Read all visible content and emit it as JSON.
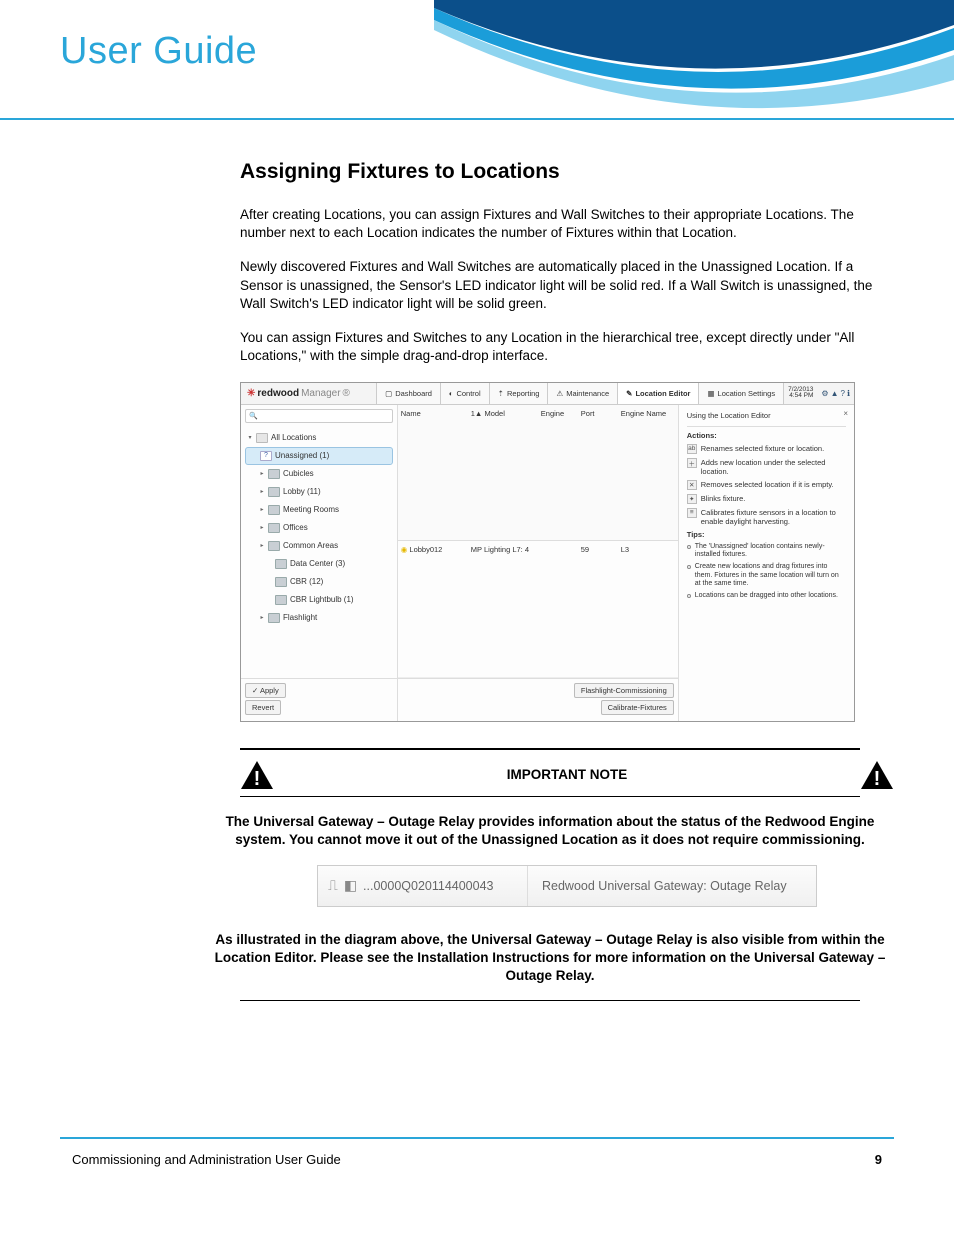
{
  "header": {
    "title": "User Guide"
  },
  "section": {
    "heading": "Assigning Fixtures to Locations"
  },
  "paragraphs": {
    "p1": "After creating Locations, you can assign Fixtures and Wall Switches to their appropriate Locations. The number next to each Location indicates the number of Fixtures within that Location.",
    "p2": "Newly discovered Fixtures and Wall Switches are automatically placed in the Unassigned Location. If a Sensor is unassigned, the Sensor's LED indicator light will be solid red. If a Wall Switch is unassigned, the Wall Switch's LED indicator light will be solid green.",
    "p3": "You can assign Fixtures and Switches to any Location in the hierarchical tree, except directly under \"All Locations,\" with the simple drag-and-drop interface."
  },
  "screenshot": {
    "brand_bold": "redwood",
    "brand_thin": "Manager",
    "brand_tm": "®",
    "tabs": {
      "dashboard": "Dashboard",
      "control": "Control",
      "reporting": "Reporting",
      "maintenance": "Maintenance",
      "location_editor": "Location Editor",
      "location_settings": "Location Settings"
    },
    "datetime": {
      "date": "7/2/2013",
      "time": "4:54 PM"
    },
    "search_placeholder": "",
    "tree": {
      "root": "All Locations",
      "unassigned": "Unassigned  (1)",
      "items": [
        "Cubicles",
        "Lobby  (11)",
        "Meeting Rooms",
        "Offices",
        "Common Areas",
        "Data Center  (3)",
        "CBR  (12)",
        "CBR Lightbulb  (1)",
        "Flashlight"
      ]
    },
    "left_buttons": {
      "apply": "✓ Apply",
      "revert": "Revert"
    },
    "grid": {
      "headers": {
        "name": "Name",
        "model": "1▲  Model",
        "engine": "Engine",
        "port": "Port",
        "engine_name": "Engine Name"
      },
      "row": {
        "name": "Lobby012",
        "model": "MP Lighting L7:  4",
        "engine": "",
        "port": "59",
        "engine_name": "L3"
      }
    },
    "center_buttons": {
      "flashlight": "Flashlight-Commissioning",
      "calibrate": "Calibrate-Fixtures"
    },
    "help": {
      "title": "Using the Location Editor",
      "actions_label": "Actions:",
      "actions": {
        "rename": "Renames selected fixture or location.",
        "add": "Adds new location under the selected location.",
        "remove": "Removes selected location if it is empty.",
        "blink": "Blinks fixture.",
        "calibrate": "Calibrates fixture sensors in a location to enable daylight harvesting."
      },
      "tips_label": "Tips:",
      "tips": {
        "t1": "The 'Unassigned' location contains newly-installed fixtures.",
        "t2": "Create new locations and drag fixtures into them. Fixtures in the same location will turn on at the same time.",
        "t3": "Locations can be dragged into other locations."
      }
    }
  },
  "note": {
    "label": "IMPORTANT NOTE",
    "text1": "The Universal Gateway – Outage Relay provides information about the status of the Redwood Engine system. You cannot move it out of the Unassigned Location as it does not require commissioning.",
    "text2": "As illustrated in the diagram above, the Universal Gateway – Outage Relay is also visible from within the Location Editor. Please see the Installation Instructions for more information on the Universal Gateway – Outage Relay."
  },
  "gateway": {
    "id": "...0000Q020114400043",
    "desc": "Redwood Universal Gateway: Outage Relay"
  },
  "footer": {
    "doc": "Commissioning and Administration User Guide",
    "page": "9"
  }
}
